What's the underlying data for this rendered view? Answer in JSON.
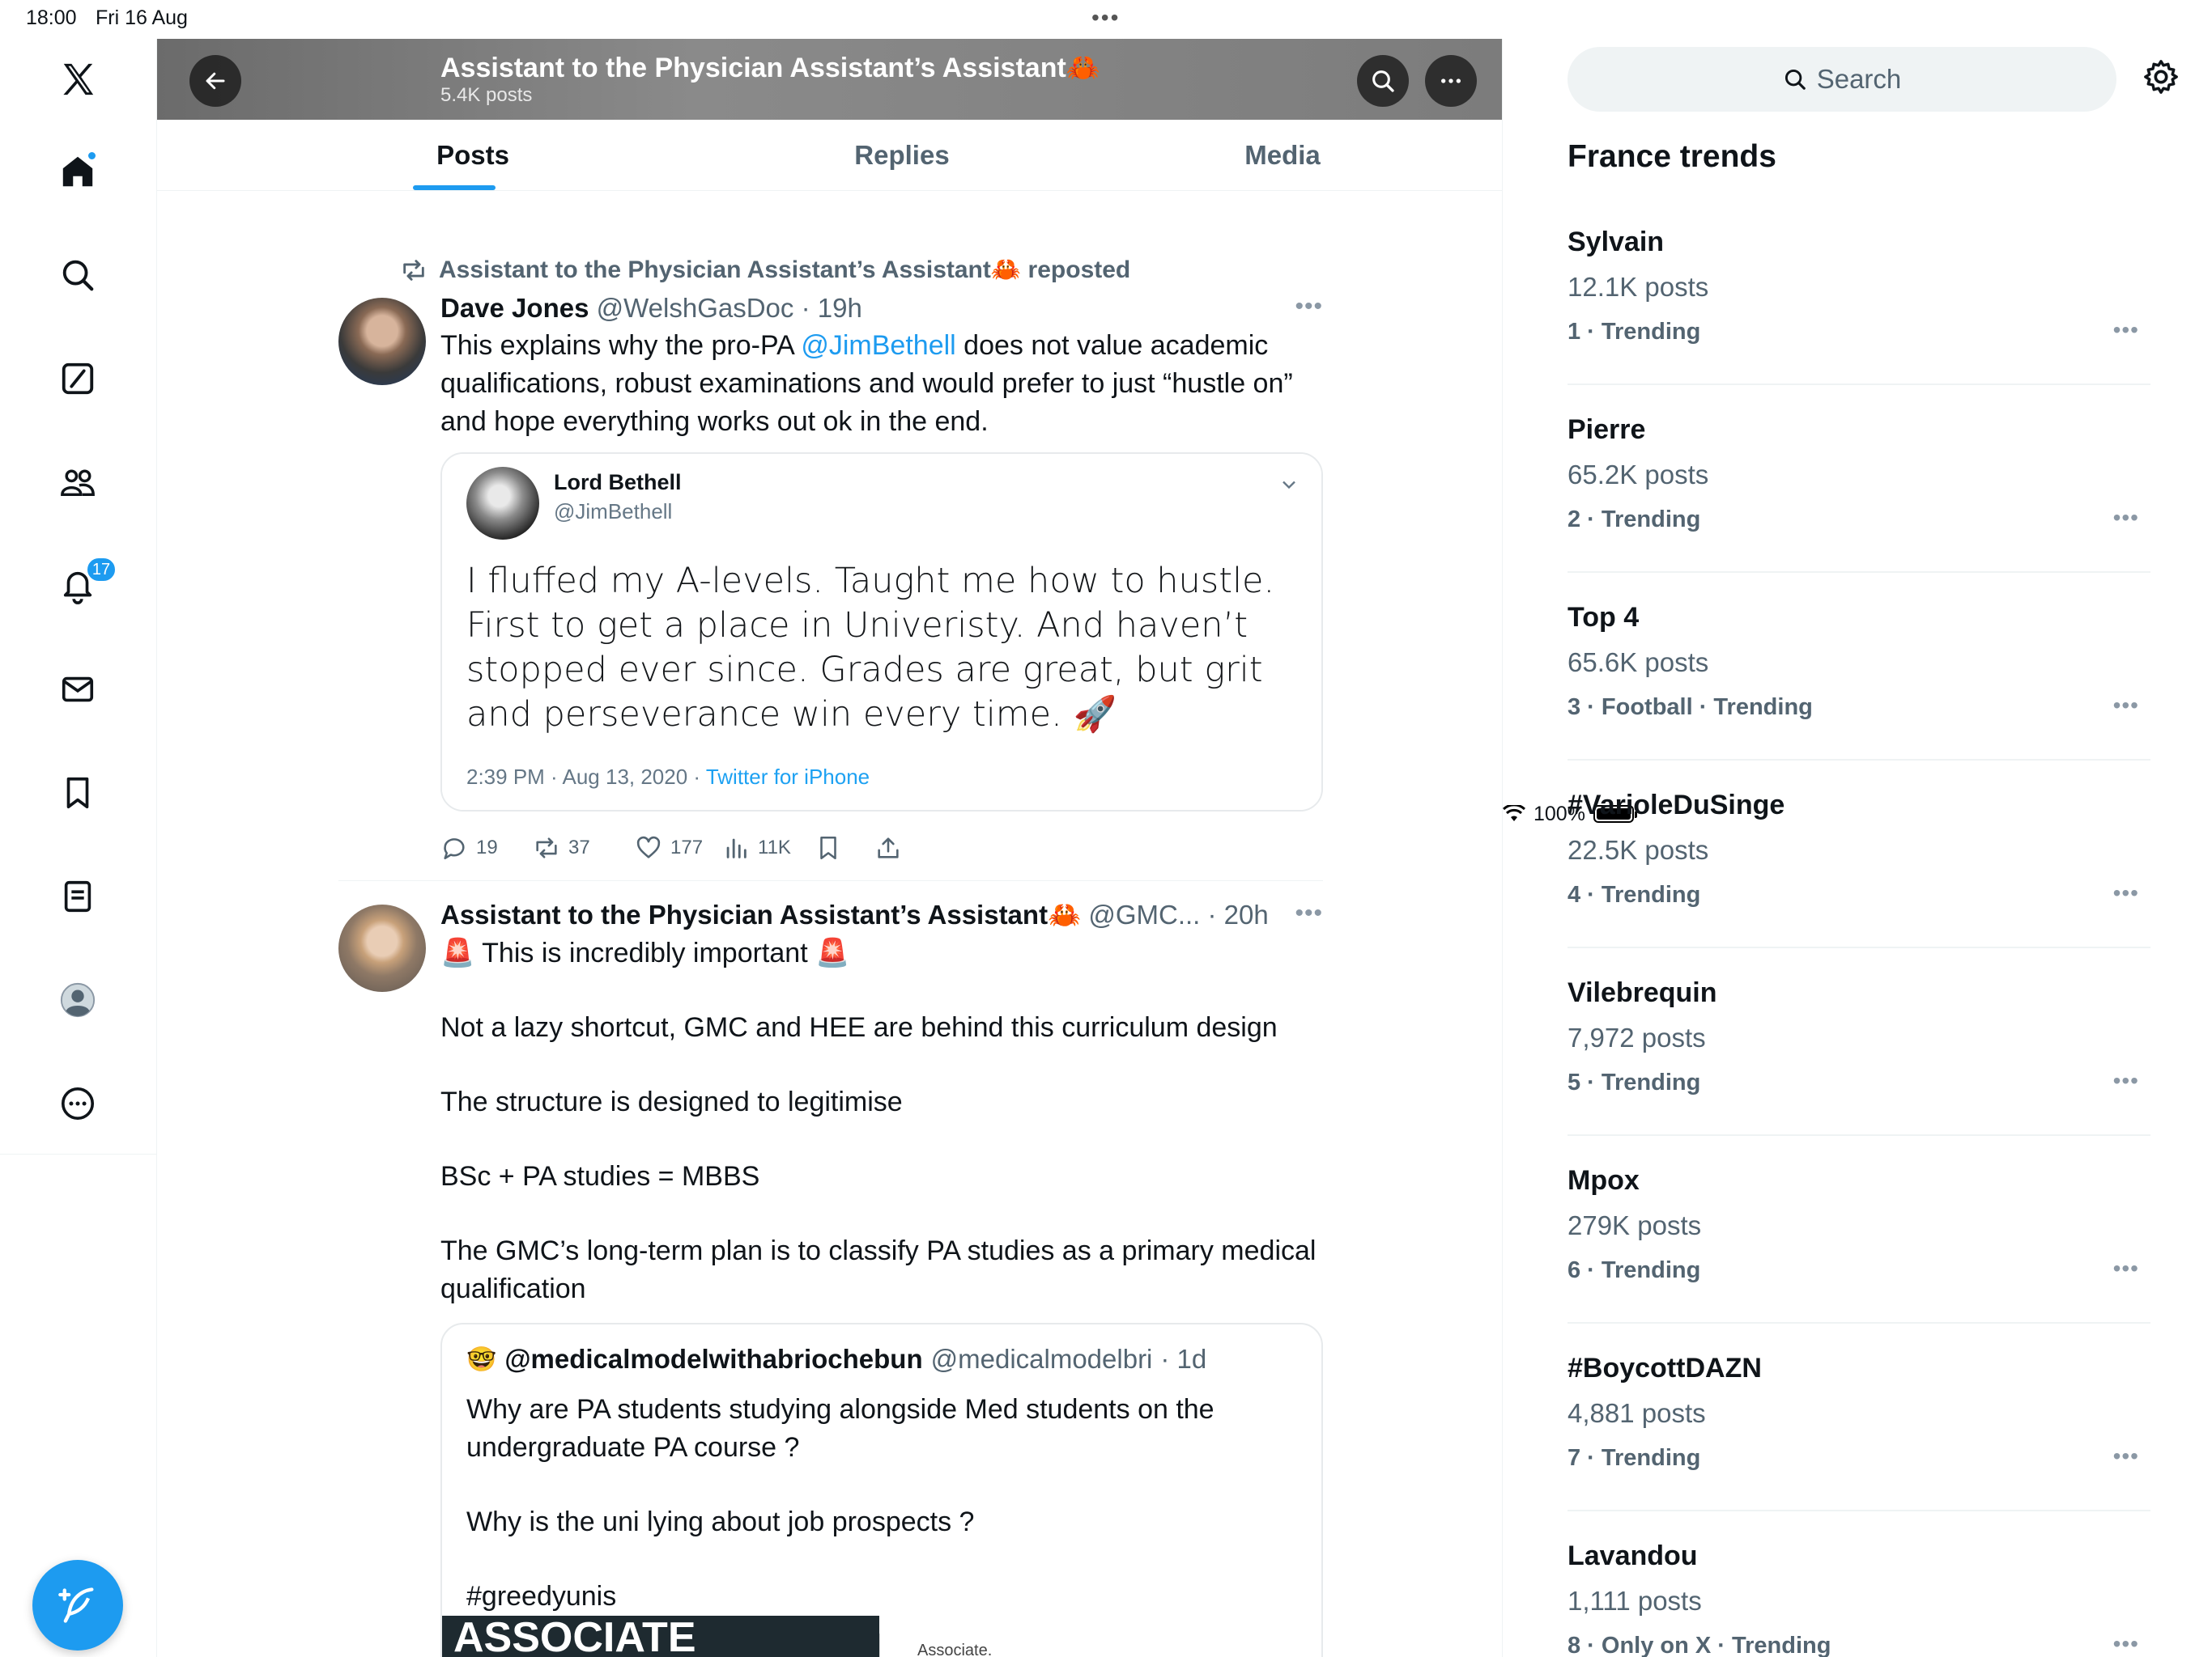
{
  "status_bar": {
    "time": "18:00",
    "date": "Fri 16 Aug",
    "battery": "100%"
  },
  "nav": {
    "notifications_badge": "17",
    "icons": [
      "x-logo-icon",
      "home-icon",
      "search-icon",
      "grok-icon",
      "communities-icon",
      "notifications-icon",
      "messages-icon",
      "bookmarks-icon",
      "lists-icon",
      "profile-icon",
      "more-icon",
      "compose-icon"
    ]
  },
  "header": {
    "title": "Assistant to the Physician Assistant’s Assistant🦀",
    "posts_count": "5.4K posts"
  },
  "tabs": [
    "Posts",
    "Replies",
    "Media"
  ],
  "tweets": [
    {
      "repost_label": "Assistant to the Physician Assistant’s Assistant🦀 reposted",
      "author_name": "Dave Jones",
      "author_handle": "@WelshGasDoc",
      "time": "· 19h",
      "text_before": "This explains why the pro-PA ",
      "mention": "@JimBethell",
      "text_after": " does not value academic qualifications, robust examinations and would prefer to just “hustle on” and hope everything works out ok in the end.",
      "embedded_tweet": {
        "name": "Lord Bethell",
        "handle": "@JimBethell",
        "text": "I fluffed my A-levels. Taught me how to hustle. First to get a place in Univeristy. And haven’t stopped ever since. Grades are great, but grit and perseverance win every time. 🚀",
        "timestamp": "2:39 PM · Aug 13, 2020 · ",
        "source": "Twitter for iPhone"
      },
      "stats": {
        "replies": "19",
        "reposts": "37",
        "likes": "177",
        "views": "11K"
      }
    },
    {
      "author_name": "Assistant to the Physician Assistant’s Assistant🦀",
      "author_handle": "@GMC...",
      "time": "· 20h",
      "paragraphs": [
        "🚨 This is incredibly important 🚨",
        "Not a lazy shortcut, GMC and HEE are behind this curriculum design",
        "The structure is designed to legitimise",
        "BSc + PA studies = MBBS",
        "The GMC’s long-term plan is to classify PA studies as a primary medical qualification"
      ],
      "quote": {
        "emoji": "🤓",
        "name": "@medicalmodelwithabriochebun",
        "handle": "@medicalmodelbri",
        "time": "· 1d",
        "paragraphs": [
          "Why are PA students studying alongside Med students on the undergraduate PA course ?",
          "Why is the uni lying about job prospects ?",
          "#greedyunis"
        ],
        "image_text": "ASSOCIATE\nSTUDIES",
        "image_side_text": "Associate."
      }
    }
  ],
  "sidebar": {
    "search_placeholder": "Search",
    "trends_title": "France trends",
    "trends": [
      {
        "name": "Sylvain",
        "posts": "12.1K posts",
        "meta": "1 · Trending"
      },
      {
        "name": "Pierre",
        "posts": "65.2K posts",
        "meta": "2 · Trending"
      },
      {
        "name": "Top 4",
        "posts": "65.6K posts",
        "meta": "3 · Football · Trending"
      },
      {
        "name": "#VarioleDuSinge",
        "posts": "22.5K posts",
        "meta": "4 · Trending"
      },
      {
        "name": "Vilebrequin",
        "posts": "7,972 posts",
        "meta": "5 · Trending"
      },
      {
        "name": "Mpox",
        "posts": "279K posts",
        "meta": "6 · Trending"
      },
      {
        "name": "#BoycottDAZN",
        "posts": "4,881 posts",
        "meta": "7 · Trending"
      },
      {
        "name": "Lavandou",
        "posts": "1,111 posts",
        "meta": "8 · Only on X · Trending"
      }
    ]
  },
  "colors": {
    "accent": "#1d9bf0",
    "text": "#0f1419",
    "secondary": "#536471"
  }
}
